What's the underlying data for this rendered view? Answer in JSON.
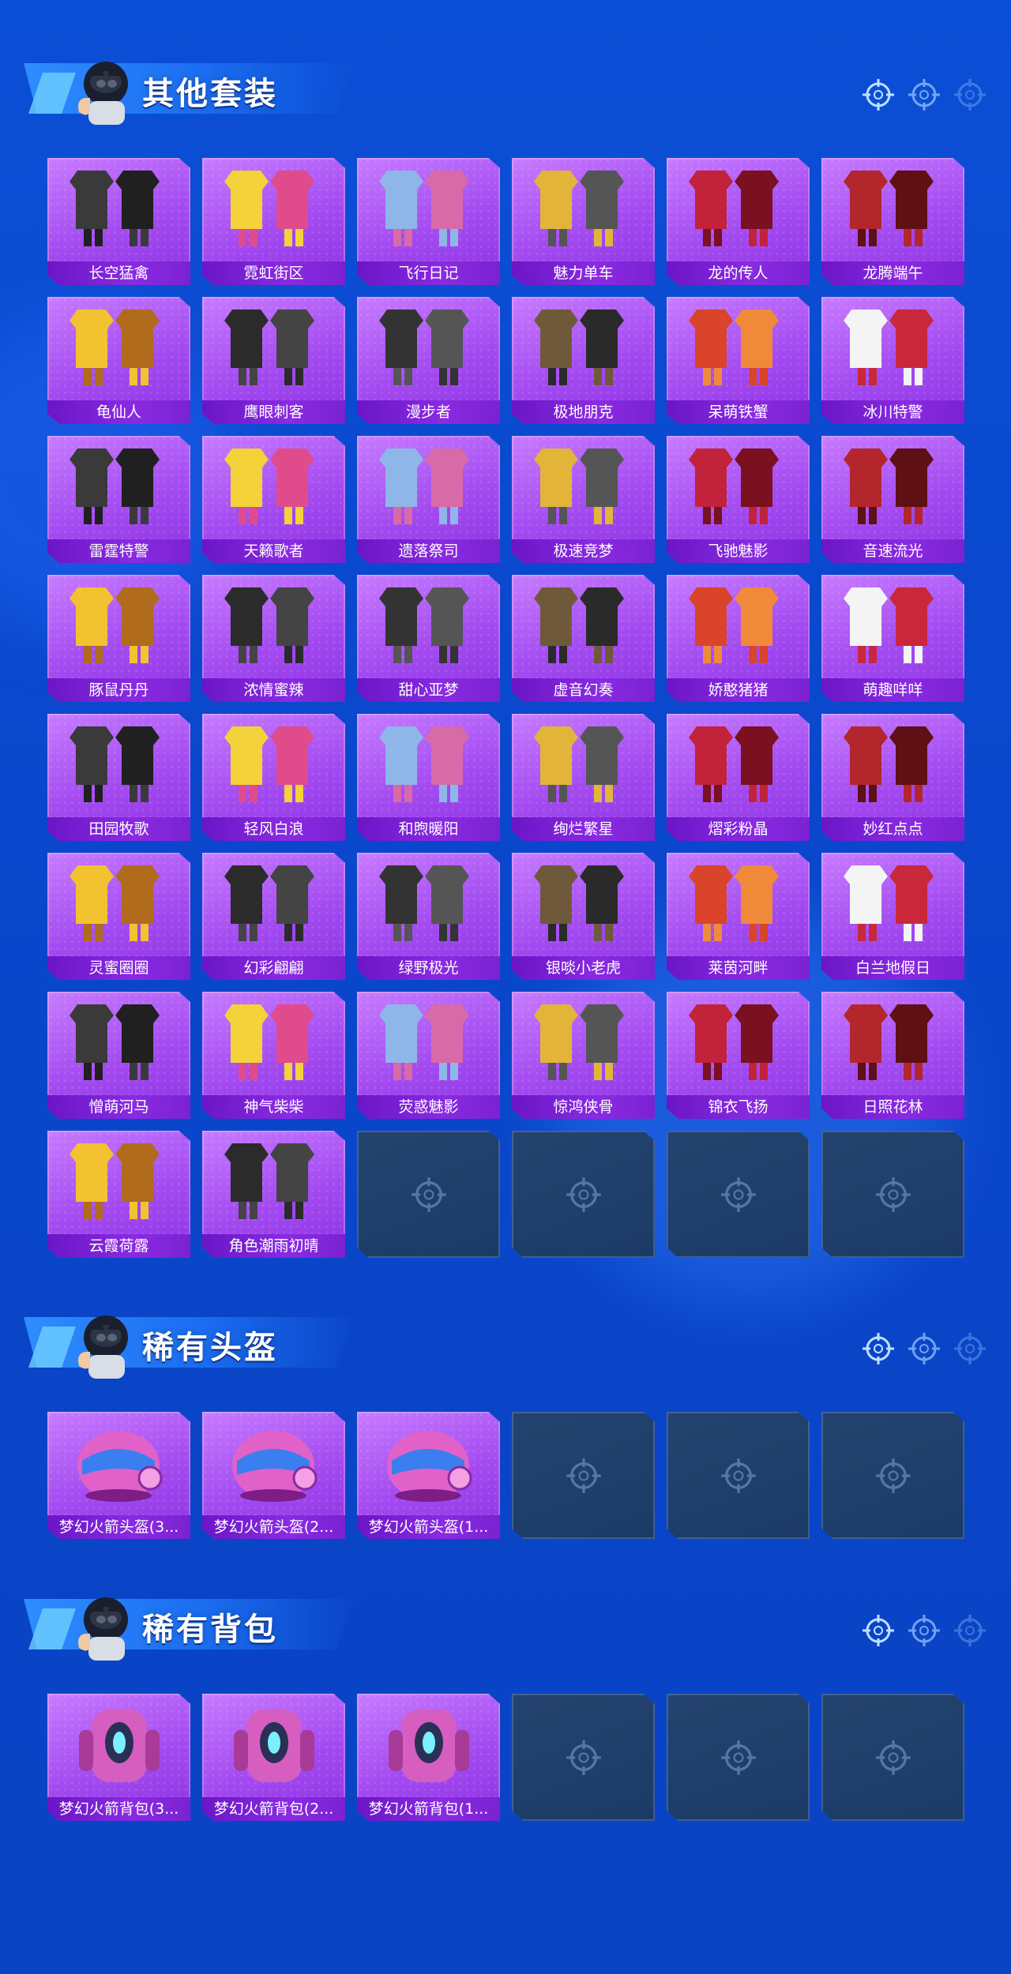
{
  "colors": {
    "background": "#0b4fd6",
    "card": "#a34bf0",
    "label_bar": "#7a22d2",
    "empty_slot": "#1f3d69"
  },
  "sections": [
    {
      "title": "其他套装",
      "items": [
        "长空猛禽",
        "霓虹街区",
        "飞行日记",
        "魅力单车",
        "龙的传人",
        "龙腾端午",
        "龟仙人",
        "鹰眼刺客",
        "漫步者",
        "极地朋克",
        "呆萌铁蟹",
        "冰川特警",
        "雷霆特警",
        "天籁歌者",
        "遗落祭司",
        "极速竞梦",
        "飞驰魅影",
        "音速流光",
        "豚鼠丹丹",
        "浓情蜜辣",
        "甜心亚梦",
        "虚音幻奏",
        "娇憨猪猪",
        "萌趣咩咩",
        "田园牧歌",
        "轻风白浪",
        "和煦暖阳",
        "绚烂繁星",
        "熠彩粉晶",
        "妙红点点",
        "灵蜜圈圈",
        "幻彩翩翩",
        "绿野极光",
        "银啖小老虎",
        "莱茵河畔",
        "白兰地假日",
        "憎萌河马",
        "神气柴柴",
        "荧惑魅影",
        "惊鸿侠骨",
        "锦衣飞扬",
        "日照花林",
        "云霞荷露",
        "角色潮雨初晴"
      ],
      "empty_slots": 4
    },
    {
      "title": "稀有头盔",
      "items": [
        "梦幻火箭头盔(3...",
        "梦幻火箭头盔(2...",
        "梦幻火箭头盔(1..."
      ],
      "empty_slots": 3
    },
    {
      "title": "稀有背包",
      "items": [
        "梦幻火箭背包(3...",
        "梦幻火箭背包(2...",
        "梦幻火箭背包(1..."
      ],
      "empty_slots": 3
    }
  ],
  "icons": {
    "section_avatar": "helmeted-character-thumbs-up-icon",
    "header_deco": "crosshair-target-icon",
    "empty_slot": "crosshair-target-icon",
    "outfit": "outfit-icon",
    "helmet": "helmet-icon",
    "backpack": "backpack-icon"
  }
}
